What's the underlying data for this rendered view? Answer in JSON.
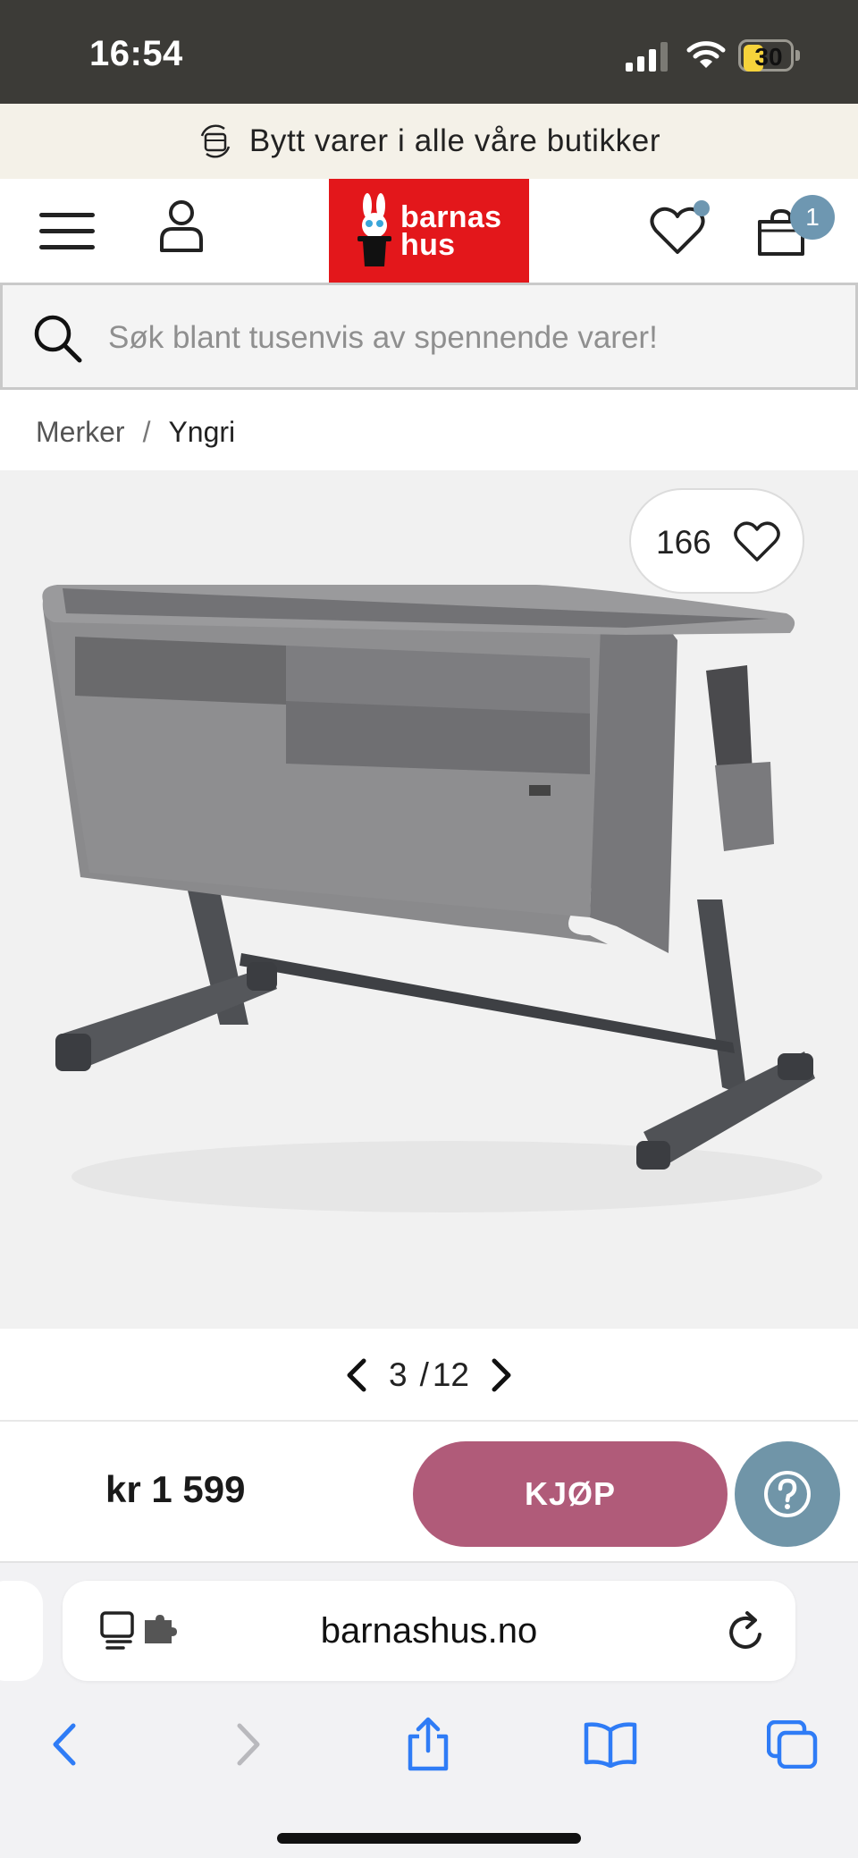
{
  "status_bar": {
    "time": "16:54",
    "battery": "30",
    "battery_color": "#f6d33b"
  },
  "promo": {
    "icon": "exchange-box-icon",
    "text": "Bytt varer i alle våre butikker"
  },
  "header": {
    "menu_icon": "hamburger-menu-icon",
    "account_icon": "user-icon",
    "logo": {
      "line1": "barnas",
      "line2": "hus",
      "color": "#e3171b"
    },
    "wishlist_icon": "heart-icon",
    "cart_icon": "shopping-bag-icon",
    "cart_count": "1",
    "badge_color": "#6e97b1"
  },
  "search": {
    "placeholder": "Søk blant tusenvis av spennende varer!",
    "value": ""
  },
  "breadcrumb": {
    "items": [
      "Merker",
      "Yngri"
    ],
    "separator": "/"
  },
  "product": {
    "image_alt": "Grey bedside crib on dark metal frame with wheels",
    "like_count": "166",
    "pager": {
      "current": "3",
      "separator": "/",
      "total": "12"
    }
  },
  "buy_bar": {
    "price": "kr 1 599",
    "buy_label": "KJØP",
    "buy_color": "#b05b79",
    "help_icon": "question-mark-icon",
    "help_color": "#7095a8"
  },
  "browser": {
    "url": "barnashus.no",
    "toolbar": [
      "back-icon",
      "forward-icon",
      "share-icon",
      "bookmarks-icon",
      "tabs-icon"
    ]
  }
}
